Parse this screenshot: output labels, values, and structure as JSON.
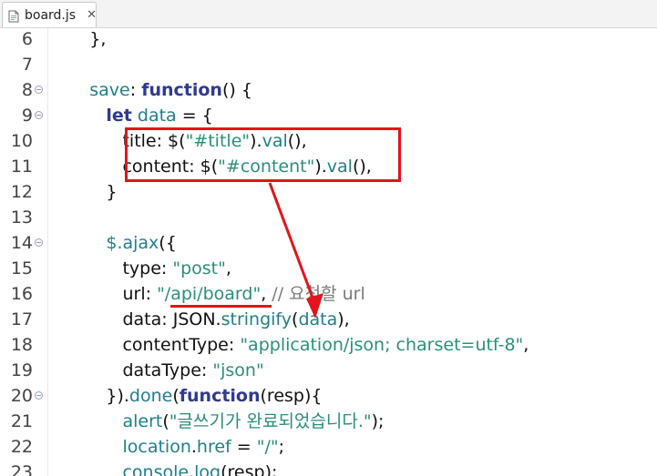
{
  "tab": {
    "filename": "board.js",
    "close_label": "✕"
  },
  "lines": [
    {
      "no": "6",
      "fold": false,
      "tokens": [
        {
          "t": "      },",
          "c": "def"
        }
      ]
    },
    {
      "no": "7",
      "fold": false,
      "tokens": []
    },
    {
      "no": "8",
      "fold": true,
      "tokens": [
        {
          "t": "      ",
          "c": "def"
        },
        {
          "t": "save",
          "c": "fn"
        },
        {
          "t": ": ",
          "c": "def"
        },
        {
          "t": "function",
          "c": "kw"
        },
        {
          "t": "() {",
          "c": "def"
        }
      ]
    },
    {
      "no": "9",
      "fold": true,
      "tokens": [
        {
          "t": "         ",
          "c": "def"
        },
        {
          "t": "let",
          "c": "kw"
        },
        {
          "t": " ",
          "c": "def"
        },
        {
          "t": "data",
          "c": "fn"
        },
        {
          "t": " = {",
          "c": "def"
        }
      ]
    },
    {
      "no": "10",
      "fold": false,
      "tokens": [
        {
          "t": "            title: $(",
          "c": "def"
        },
        {
          "t": "\"#title\"",
          "c": "str"
        },
        {
          "t": ").",
          "c": "def"
        },
        {
          "t": "val",
          "c": "fn"
        },
        {
          "t": "(),",
          "c": "def"
        }
      ]
    },
    {
      "no": "11",
      "fold": false,
      "tokens": [
        {
          "t": "            content: $(",
          "c": "def"
        },
        {
          "t": "\"#content\"",
          "c": "str"
        },
        {
          "t": ").",
          "c": "def"
        },
        {
          "t": "val",
          "c": "fn"
        },
        {
          "t": "(),",
          "c": "def"
        }
      ]
    },
    {
      "no": "12",
      "fold": false,
      "tokens": [
        {
          "t": "         }",
          "c": "def"
        }
      ]
    },
    {
      "no": "13",
      "fold": false,
      "tokens": []
    },
    {
      "no": "14",
      "fold": true,
      "tokens": [
        {
          "t": "         ",
          "c": "def"
        },
        {
          "t": "$.ajax",
          "c": "fn"
        },
        {
          "t": "({",
          "c": "def"
        }
      ]
    },
    {
      "no": "15",
      "fold": false,
      "tokens": [
        {
          "t": "            type: ",
          "c": "def"
        },
        {
          "t": "\"post\"",
          "c": "str"
        },
        {
          "t": ",",
          "c": "def"
        }
      ]
    },
    {
      "no": "16",
      "fold": false,
      "tokens": [
        {
          "t": "            url: ",
          "c": "def"
        },
        {
          "t": "\"/api/board\"",
          "c": "str"
        },
        {
          "t": ", ",
          "c": "def"
        },
        {
          "t": "// 요청할 url",
          "c": "cm"
        }
      ]
    },
    {
      "no": "17",
      "fold": false,
      "tokens": [
        {
          "t": "            data: JSON.",
          "c": "def"
        },
        {
          "t": "stringify",
          "c": "fn"
        },
        {
          "t": "(",
          "c": "def"
        },
        {
          "t": "data",
          "c": "fn"
        },
        {
          "t": "),",
          "c": "def"
        }
      ]
    },
    {
      "no": "18",
      "fold": false,
      "tokens": [
        {
          "t": "            contentType: ",
          "c": "def"
        },
        {
          "t": "\"application/json; charset=utf-8\"",
          "c": "str"
        },
        {
          "t": ",",
          "c": "def"
        }
      ]
    },
    {
      "no": "19",
      "fold": false,
      "tokens": [
        {
          "t": "            dataType: ",
          "c": "def"
        },
        {
          "t": "\"json\"",
          "c": "str"
        }
      ]
    },
    {
      "no": "20",
      "fold": true,
      "tokens": [
        {
          "t": "         }).",
          "c": "def"
        },
        {
          "t": "done",
          "c": "fn"
        },
        {
          "t": "(",
          "c": "def"
        },
        {
          "t": "function",
          "c": "kw"
        },
        {
          "t": "(resp){",
          "c": "def"
        }
      ]
    },
    {
      "no": "21",
      "fold": false,
      "tokens": [
        {
          "t": "            ",
          "c": "def"
        },
        {
          "t": "alert",
          "c": "fn"
        },
        {
          "t": "(",
          "c": "def"
        },
        {
          "t": "\"글쓰기가 완료되었습니다.\"",
          "c": "str"
        },
        {
          "t": ");",
          "c": "def"
        }
      ]
    },
    {
      "no": "22",
      "fold": false,
      "tokens": [
        {
          "t": "            ",
          "c": "def"
        },
        {
          "t": "location",
          "c": "fn"
        },
        {
          "t": ".",
          "c": "def"
        },
        {
          "t": "href",
          "c": "fn"
        },
        {
          "t": " = ",
          "c": "def"
        },
        {
          "t": "\"/\"",
          "c": "str"
        },
        {
          "t": ";",
          "c": "def"
        }
      ]
    },
    {
      "no": "23",
      "fold": false,
      "tokens": [
        {
          "t": "            ",
          "c": "def"
        },
        {
          "t": "console",
          "c": "fn"
        },
        {
          "t": ".",
          "c": "def"
        },
        {
          "t": "log",
          "c": "fn"
        },
        {
          "t": "(resp);",
          "c": "def"
        }
      ]
    }
  ],
  "colors": {
    "annotation": "#e3141b",
    "keyword": "#2f3a8f",
    "function": "#1f7f8c",
    "string": "#2a8f7a",
    "comment": "#7a7a7a"
  }
}
